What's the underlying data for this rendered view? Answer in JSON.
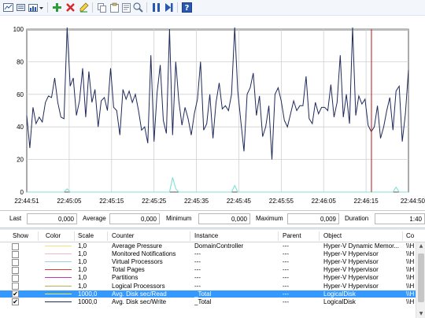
{
  "toolbar": {
    "buttons": [
      {
        "name": "view-graph-button",
        "icon": "graph-view-icon"
      },
      {
        "name": "clear-display-button",
        "icon": "clear-icon"
      },
      {
        "name": "change-graph-type-button",
        "icon": "graph-type-icon"
      },
      {
        "name": "add-counter-button",
        "icon": "plus-icon"
      },
      {
        "name": "delete-counter-button",
        "icon": "delete-x-icon"
      },
      {
        "name": "highlight-button",
        "icon": "highlight-pen-icon"
      },
      {
        "name": "copy-properties-button",
        "icon": "copy-icon"
      },
      {
        "name": "paste-counter-list-button",
        "icon": "paste-icon"
      },
      {
        "name": "properties-button",
        "icon": "properties-icon"
      },
      {
        "name": "zoom-button",
        "icon": "zoom-icon"
      },
      {
        "name": "freeze-display-button",
        "icon": "pause-icon"
      },
      {
        "name": "update-data-button",
        "icon": "step-forward-icon"
      },
      {
        "name": "help-button",
        "icon": "help-icon"
      }
    ]
  },
  "graph": {
    "y_ticks": [
      "100",
      "80",
      "60",
      "40",
      "20",
      "0"
    ],
    "x_ticks": [
      "22:44:51",
      "22:45:05",
      "22:45:15",
      "22:45:25",
      "22:45:35",
      "22:45:45",
      "22:45:55",
      "22:46:05",
      "22:46:15",
      "22:44:50"
    ],
    "colors": {
      "main_series": "#1f2a5c",
      "secondary_series": "#7fe0d8",
      "time_bar": "#c43a3a"
    },
    "chart_data": {
      "type": "line",
      "ylim": [
        0,
        100
      ],
      "series": [
        {
          "values": [
            47,
            27,
            52,
            42,
            46,
            43,
            55,
            59,
            58,
            70,
            55,
            46,
            45,
            101,
            65,
            70,
            47,
            56,
            76,
            46,
            74,
            55,
            63,
            40,
            56,
            58,
            50,
            76,
            52,
            50,
            35,
            63,
            57,
            62,
            55,
            60,
            50,
            38,
            40,
            30,
            84,
            31,
            61,
            78,
            44,
            36,
            100,
            35,
            80,
            56,
            41,
            52,
            45,
            35,
            48,
            57,
            80,
            38,
            42,
            60,
            33,
            55,
            67,
            51,
            53,
            50,
            60,
            101,
            62,
            43,
            25,
            60,
            64,
            73,
            47,
            59,
            34,
            40,
            53,
            20,
            60,
            64,
            56,
            44,
            40,
            48,
            56,
            50,
            53,
            53,
            71,
            45,
            42,
            55,
            48,
            52,
            52,
            50,
            66,
            46,
            55,
            84,
            46,
            60,
            42,
            101,
            47,
            59,
            54,
            57,
            41,
            37,
            40,
            53,
            33,
            40,
            50,
            58,
            38,
            62,
            65,
            31,
            48,
            75
          ],
          "x_fraction_note": "sampled across the full visible time window"
        },
        {
          "values": [
            0,
            0,
            0,
            0,
            0,
            0,
            0,
            0,
            0,
            0,
            0,
            0,
            0,
            2,
            0,
            0,
            0,
            0,
            0,
            0,
            0,
            0,
            0,
            0,
            0,
            0,
            0,
            0,
            0,
            0,
            0,
            0,
            0,
            0,
            0,
            0,
            0,
            0,
            0,
            0,
            0,
            0,
            0,
            0,
            0,
            0,
            0,
            9,
            2,
            0,
            0,
            0,
            0,
            0,
            0,
            0,
            0,
            0,
            0,
            0,
            0,
            0,
            0,
            0,
            0,
            0,
            0,
            4,
            0,
            0,
            0,
            0,
            0,
            0,
            0,
            0,
            0,
            0,
            0,
            0,
            0,
            0,
            0,
            0,
            0,
            0,
            0,
            0,
            0,
            0,
            0,
            0,
            0,
            0,
            0,
            0,
            0,
            0,
            0,
            0,
            0,
            0,
            0,
            0,
            0,
            0,
            0,
            0,
            0,
            0,
            0,
            0,
            0,
            0,
            0,
            0,
            0,
            0,
            0,
            3,
            0,
            0,
            0,
            0
          ]
        }
      ]
    }
  },
  "stats": {
    "last_label": "Last",
    "last_value": "0,000",
    "average_label": "Average",
    "average_value": "0,000",
    "minimum_label": "Minimum",
    "minimum_value": "0,000",
    "maximum_label": "Maximum",
    "maximum_value": "0,009",
    "duration_label": "Duration",
    "duration_value": "1:40"
  },
  "list": {
    "columns": [
      "Show",
      "Color",
      "Scale",
      "Counter",
      "Instance",
      "Parent",
      "Object",
      "Co"
    ],
    "rows": [
      {
        "checked": false,
        "color": "#f2e07a",
        "scale": "1,0",
        "counter": "Average Pressure",
        "instance": "DomainController",
        "parent": "---",
        "object": "Hyper-V Dynamic Memor...",
        "computer": "\\\\H"
      },
      {
        "checked": false,
        "color": "#f0b8d2",
        "scale": "1,0",
        "counter": "Monitored Notifications",
        "instance": "---",
        "parent": "---",
        "object": "Hyper-V Hypervisor",
        "computer": "\\\\H"
      },
      {
        "checked": false,
        "color": "#9fd0e8",
        "scale": "1,0",
        "counter": "Virtual Processors",
        "instance": "---",
        "parent": "---",
        "object": "Hyper-V Hypervisor",
        "computer": "\\\\H"
      },
      {
        "checked": false,
        "color": "#e03a3a",
        "scale": "1,0",
        "counter": "Total Pages",
        "instance": "---",
        "parent": "---",
        "object": "Hyper-V Hypervisor",
        "computer": "\\\\H"
      },
      {
        "checked": false,
        "color": "#c23aa8",
        "scale": "1,0",
        "counter": "Partitions",
        "instance": "---",
        "parent": "---",
        "object": "Hyper-V Hypervisor",
        "computer": "\\\\H"
      },
      {
        "checked": false,
        "color": "#b9b05a",
        "scale": "1,0",
        "counter": "Logical Processors",
        "instance": "---",
        "parent": "---",
        "object": "Hyper-V Hypervisor",
        "computer": "\\\\H"
      },
      {
        "checked": true,
        "color": "#e9f25a",
        "scale": "1000,0",
        "counter": "Avg. Disk sec/Read",
        "instance": "_Total",
        "parent": "---",
        "object": "LogicalDisk",
        "computer": "\\\\H",
        "selected": true
      },
      {
        "checked": true,
        "color": "#1f2a5c",
        "scale": "1000,0",
        "counter": "Avg. Disk sec/Write",
        "instance": "_Total",
        "parent": "---",
        "object": "LogicalDisk",
        "computer": "\\\\H"
      }
    ]
  }
}
